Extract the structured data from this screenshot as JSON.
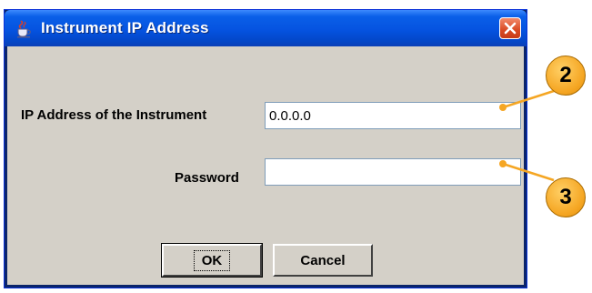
{
  "window": {
    "title": "Instrument IP Address",
    "icon": "java-cup-icon",
    "close_icon": "close-x-icon"
  },
  "form": {
    "ip_label": "IP Address of the Instrument",
    "ip_value": "0.0.0.0",
    "password_label": "Password",
    "password_value": ""
  },
  "buttons": {
    "ok_label": "OK",
    "cancel_label": "Cancel"
  },
  "callouts": {
    "ip_number": "2",
    "password_number": "3",
    "color": "#f5a623"
  },
  "colors": {
    "titlebar": "#0553e0",
    "client": "#d4d0c8",
    "close": "#d94a23"
  }
}
